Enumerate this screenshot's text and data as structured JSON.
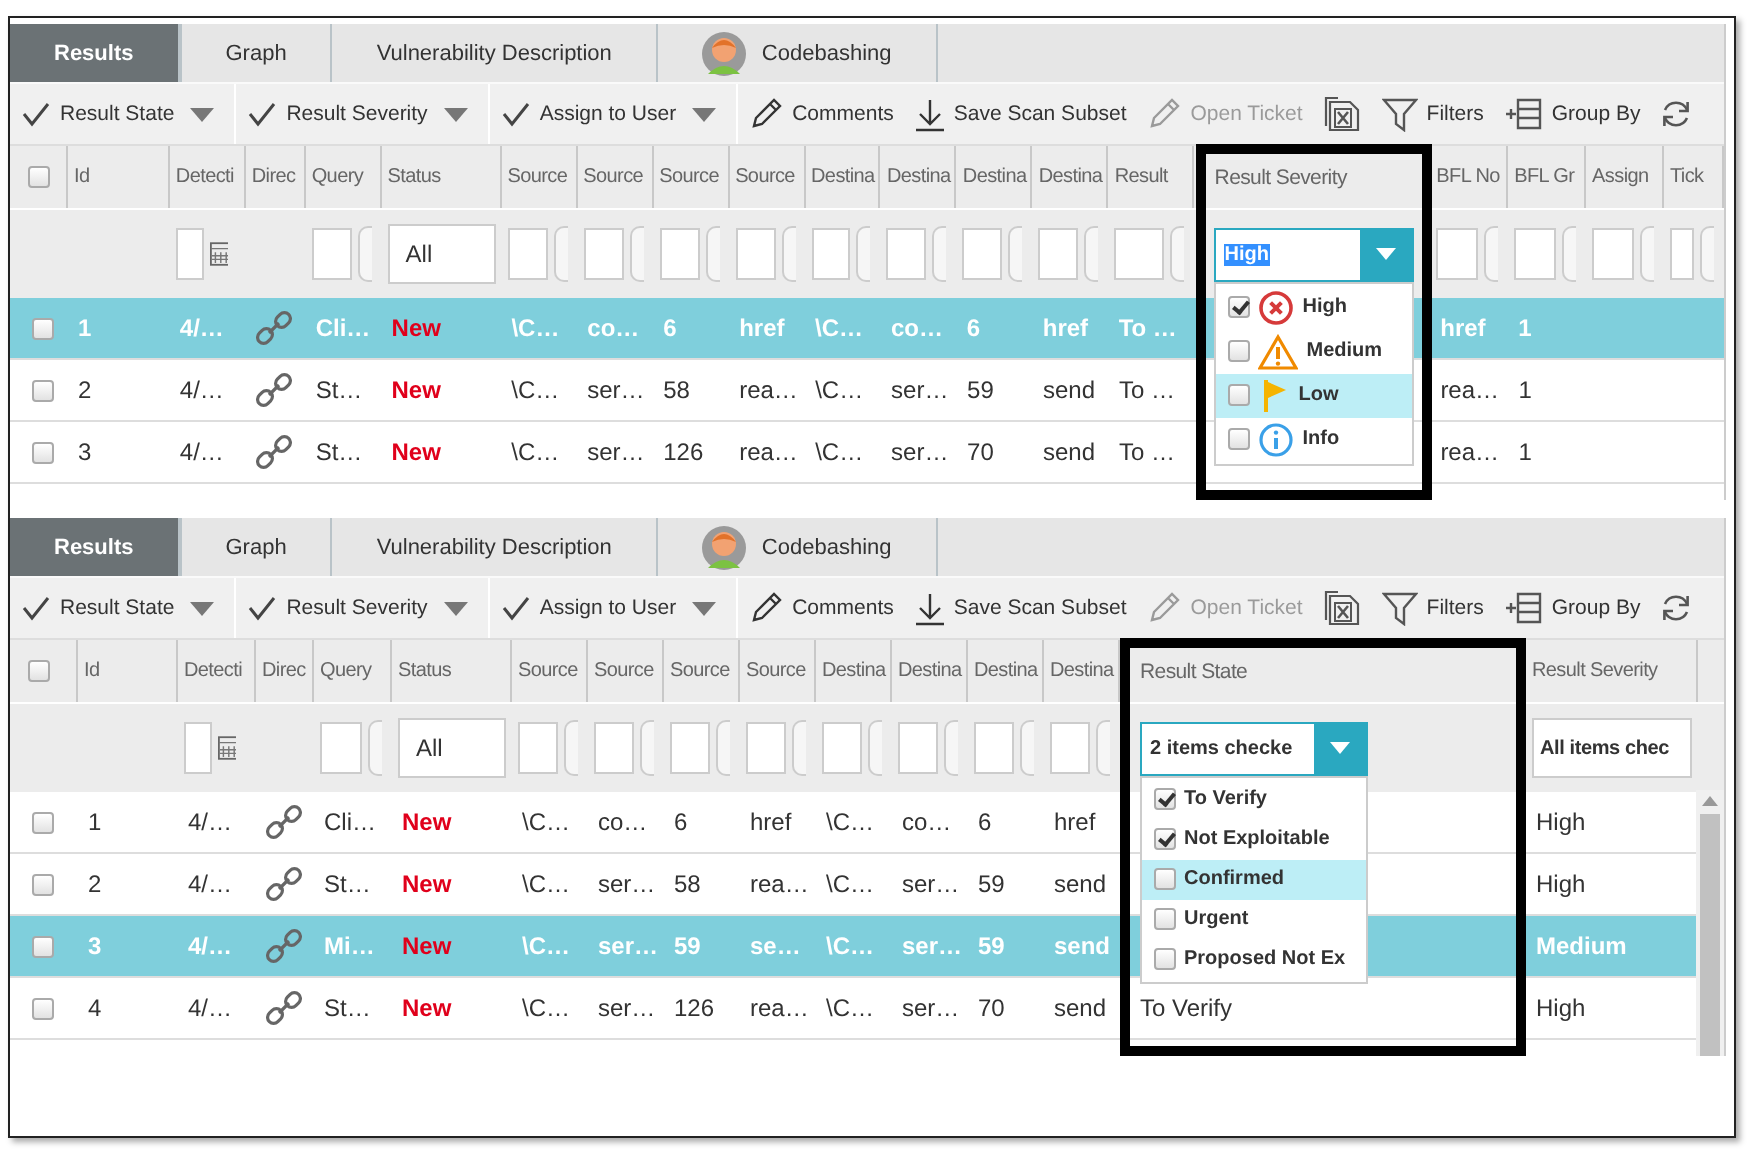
{
  "panels": [
    {
      "tabs": [
        {
          "label": "Results",
          "selected": true,
          "kind": "plain"
        },
        {
          "label": "Graph",
          "selected": false,
          "kind": "plain"
        },
        {
          "label": "Vulnerability Description",
          "selected": false,
          "kind": "plain"
        },
        {
          "label": "Codebashing",
          "selected": false,
          "kind": "avatar"
        }
      ],
      "toolbar": [
        {
          "kind": "check",
          "label": "Result State",
          "menu": true,
          "disabled": false
        },
        {
          "kind": "check",
          "label": "Result Severity",
          "menu": true,
          "disabled": false
        },
        {
          "kind": "check",
          "label": "Assign to User",
          "menu": true,
          "disabled": false
        },
        {
          "kind": "pencil",
          "label": "Comments",
          "menu": false,
          "disabled": false
        },
        {
          "kind": "download",
          "label": "Save Scan Subset",
          "menu": false,
          "disabled": false
        },
        {
          "kind": "pencil",
          "label": "Open Ticket",
          "menu": false,
          "disabled": true
        },
        {
          "kind": "excel",
          "menu": false,
          "disabled": false
        },
        {
          "kind": "funnel",
          "label": "Filters",
          "menu": false,
          "disabled": false
        },
        {
          "kind": "groupby",
          "label": "Group By",
          "menu": false,
          "disabled": false
        },
        {
          "kind": "refresh",
          "menu": false,
          "disabled": false
        }
      ],
      "all_checked": false,
      "columns": [
        {
          "kind": "checkbox",
          "filter": {
            "kind": "none"
          }
        },
        {
          "label": "Id",
          "kind": "text",
          "filter": {
            "kind": "none"
          }
        },
        {
          "label": "Detecti",
          "kind": "text",
          "filter": {
            "kind": "date"
          }
        },
        {
          "label": "Direc",
          "kind": "icon",
          "filter": {
            "kind": "none"
          }
        },
        {
          "label": "Query",
          "kind": "text",
          "filter": {
            "kind": "text"
          }
        },
        {
          "label": "Status",
          "kind": "status",
          "filter": {
            "kind": "select",
            "value": "All"
          }
        },
        {
          "label": "Source",
          "kind": "text",
          "filter": {
            "kind": "text"
          }
        },
        {
          "label": "Source",
          "kind": "text",
          "filter": {
            "kind": "text"
          }
        },
        {
          "label": "Source",
          "kind": "text",
          "filter": {
            "kind": "text"
          }
        },
        {
          "label": "Source",
          "kind": "text",
          "filter": {
            "kind": "text"
          }
        },
        {
          "label": "Destina",
          "kind": "text",
          "filter": {
            "kind": "text"
          }
        },
        {
          "label": "Destina",
          "kind": "text",
          "filter": {
            "kind": "text"
          }
        },
        {
          "label": "Destina",
          "kind": "text",
          "filter": {
            "kind": "text"
          }
        },
        {
          "label": "Destina",
          "kind": "text",
          "filter": {
            "kind": "text"
          }
        },
        {
          "label": "Result",
          "kind": "text",
          "filter": {
            "kind": "text"
          }
        },
        {
          "label": "Result Severity",
          "kind": "text",
          "framed": true,
          "filter": {
            "kind": "dropdown",
            "value": "High",
            "text_selected": true,
            "options": [
              {
                "label": "High",
                "kind": "error",
                "checked": true,
                "highlighted": false
              },
              {
                "label": "Medium",
                "kind": "warning",
                "checked": false,
                "highlighted": false
              },
              {
                "label": "Low",
                "kind": "flag",
                "checked": false,
                "highlighted": true
              },
              {
                "label": "Info",
                "kind": "info",
                "checked": false,
                "highlighted": false
              }
            ]
          }
        },
        {
          "label": "BFL No",
          "kind": "text",
          "filter": {
            "kind": "text"
          }
        },
        {
          "label": "BFL Gr",
          "kind": "text",
          "filter": {
            "kind": "text"
          }
        },
        {
          "label": "Assign",
          "kind": "text",
          "filter": {
            "kind": "text"
          }
        },
        {
          "label": "Tick",
          "kind": "text",
          "filter": {
            "kind": "text"
          }
        }
      ],
      "rows": [
        {
          "selected": true,
          "checked": false,
          "cells": [
            null,
            "1",
            "4/…",
            null,
            "Cli…",
            "New",
            "\\C…",
            "co…",
            "6",
            "href",
            "\\C…",
            "co…",
            "6",
            "href",
            "To …",
            null,
            "href",
            "1",
            null,
            null
          ]
        },
        {
          "selected": false,
          "checked": false,
          "cells": [
            null,
            "2",
            "4/…",
            null,
            "St…",
            "New",
            "\\C…",
            "ser…",
            "58",
            "rea…",
            "\\C…",
            "ser…",
            "59",
            "send",
            "To …",
            null,
            "rea…",
            "1",
            null,
            null
          ]
        },
        {
          "selected": false,
          "checked": false,
          "cells": [
            null,
            "3",
            "4/…",
            null,
            "St…",
            "New",
            "\\C…",
            "ser…",
            "126",
            "rea…",
            "\\C…",
            "ser…",
            "70",
            "send",
            "To …",
            null,
            "rea…",
            "1",
            null,
            null
          ]
        }
      ]
    },
    {
      "tabs": [
        {
          "label": "Results",
          "selected": true,
          "kind": "plain"
        },
        {
          "label": "Graph",
          "selected": false,
          "kind": "plain"
        },
        {
          "label": "Vulnerability Description",
          "selected": false,
          "kind": "plain"
        },
        {
          "label": "Codebashing",
          "selected": false,
          "kind": "avatar"
        }
      ],
      "toolbar": [
        {
          "kind": "check",
          "label": "Result State",
          "menu": true,
          "disabled": false
        },
        {
          "kind": "check",
          "label": "Result Severity",
          "menu": true,
          "disabled": false
        },
        {
          "kind": "check",
          "label": "Assign to User",
          "menu": true,
          "disabled": false
        },
        {
          "kind": "pencil",
          "label": "Comments",
          "menu": false,
          "disabled": false
        },
        {
          "kind": "download",
          "label": "Save Scan Subset",
          "menu": false,
          "disabled": false
        },
        {
          "kind": "pencil",
          "label": "Open Ticket",
          "menu": false,
          "disabled": true
        },
        {
          "kind": "excel",
          "menu": false,
          "disabled": false
        },
        {
          "kind": "funnel",
          "label": "Filters",
          "menu": false,
          "disabled": false
        },
        {
          "kind": "groupby",
          "label": "Group By",
          "menu": false,
          "disabled": false
        },
        {
          "kind": "refresh",
          "menu": false,
          "disabled": false
        }
      ],
      "all_checked": false,
      "scrollbar": true,
      "columns": [
        {
          "kind": "checkbox",
          "filter": {
            "kind": "none"
          }
        },
        {
          "label": "Id",
          "kind": "text",
          "filter": {
            "kind": "none"
          }
        },
        {
          "label": "Detecti",
          "kind": "text",
          "filter": {
            "kind": "date"
          }
        },
        {
          "label": "Direc",
          "kind": "icon",
          "filter": {
            "kind": "none"
          }
        },
        {
          "label": "Query",
          "kind": "text",
          "filter": {
            "kind": "text"
          }
        },
        {
          "label": "Status",
          "kind": "status",
          "filter": {
            "kind": "select",
            "value": "All"
          }
        },
        {
          "label": "Source",
          "kind": "text",
          "filter": {
            "kind": "text"
          }
        },
        {
          "label": "Source",
          "kind": "text",
          "filter": {
            "kind": "text"
          }
        },
        {
          "label": "Source",
          "kind": "text",
          "filter": {
            "kind": "text"
          }
        },
        {
          "label": "Source",
          "kind": "text",
          "filter": {
            "kind": "text"
          }
        },
        {
          "label": "Destina",
          "kind": "text",
          "filter": {
            "kind": "text"
          }
        },
        {
          "label": "Destina",
          "kind": "text",
          "filter": {
            "kind": "text"
          }
        },
        {
          "label": "Destina",
          "kind": "text",
          "filter": {
            "kind": "text"
          }
        },
        {
          "label": "Destina",
          "kind": "text",
          "filter": {
            "kind": "text"
          }
        },
        {
          "label": "Result State",
          "kind": "text",
          "framed": true,
          "filter": {
            "kind": "dropdown",
            "value": "2 items checke",
            "text_selected": false,
            "options": [
              {
                "label": "To Verify",
                "checked": true,
                "highlighted": false
              },
              {
                "label": "Not Exploitable",
                "checked": true,
                "highlighted": false
              },
              {
                "label": "Confirmed",
                "checked": false,
                "highlighted": true
              },
              {
                "label": "Urgent",
                "checked": false,
                "highlighted": false
              },
              {
                "label": "Proposed Not Ex",
                "checked": false,
                "highlighted": false
              }
            ]
          }
        },
        {
          "label": "Result Severity",
          "kind": "text",
          "filter": {
            "kind": "select",
            "value": "All items chec"
          }
        }
      ],
      "rows": [
        {
          "selected": false,
          "checked": false,
          "cells": [
            null,
            "1",
            "4/…",
            null,
            "Cli…",
            "New",
            "\\C…",
            "co…",
            "6",
            "href",
            "\\C…",
            "co…",
            "6",
            "href",
            null,
            "High"
          ]
        },
        {
          "selected": false,
          "checked": false,
          "cells": [
            null,
            "2",
            "4/…",
            null,
            "St…",
            "New",
            "\\C…",
            "ser…",
            "58",
            "rea…",
            "\\C…",
            "ser…",
            "59",
            "send",
            null,
            "High"
          ]
        },
        {
          "selected": true,
          "checked": false,
          "cells": [
            null,
            "3",
            "4/…",
            null,
            "Mi…",
            "New",
            "\\C…",
            "ser…",
            "59",
            "se…",
            "\\C…",
            "ser…",
            "59",
            "send",
            null,
            "Medium"
          ]
        },
        {
          "selected": false,
          "checked": false,
          "cells": [
            null,
            "4",
            "4/…",
            null,
            "St…",
            "New",
            "\\C…",
            "ser…",
            "126",
            "rea…",
            "\\C…",
            "ser…",
            "70",
            "send",
            "To Verify",
            "High"
          ]
        }
      ]
    }
  ]
}
